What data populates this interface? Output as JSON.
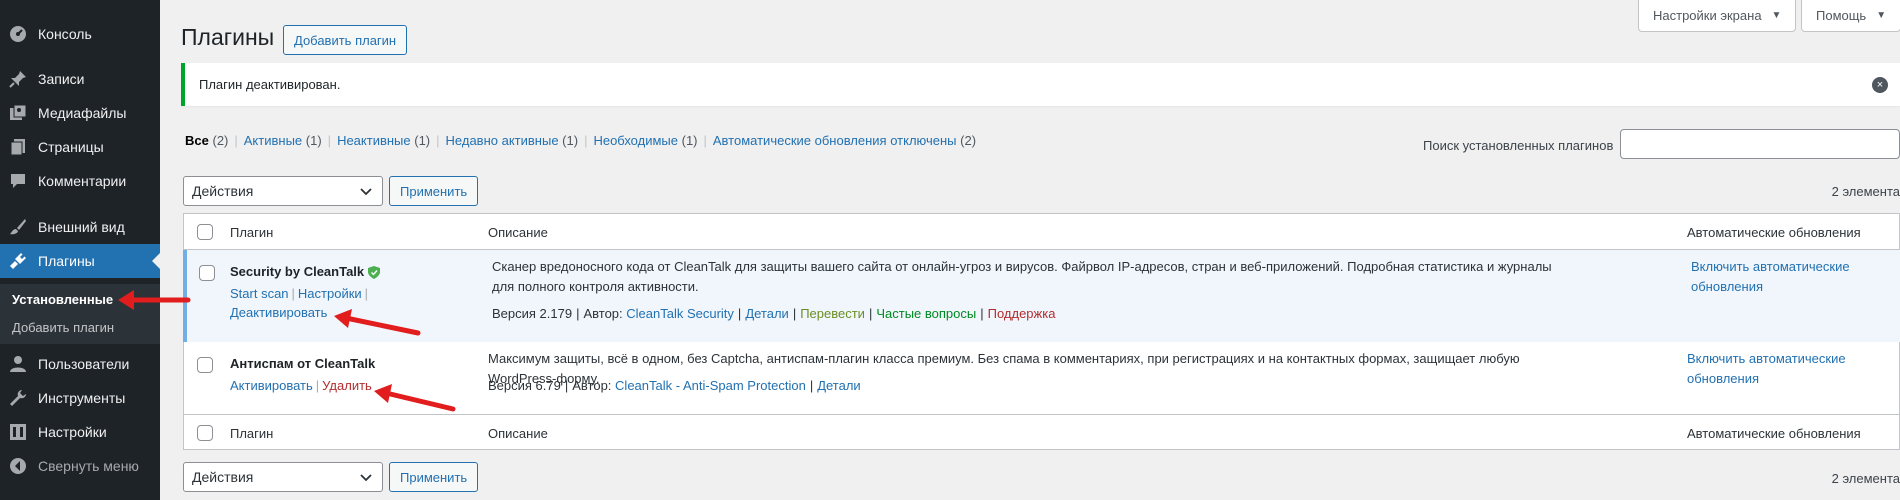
{
  "sidebar": {
    "items": [
      {
        "label": "Консоль",
        "icon": "dashboard-icon"
      },
      {
        "label": "Записи",
        "icon": "pin-icon"
      },
      {
        "label": "Медиафайлы",
        "icon": "media-icon"
      },
      {
        "label": "Страницы",
        "icon": "page-icon"
      },
      {
        "label": "Комментарии",
        "icon": "comment-icon"
      },
      {
        "label": "Внешний вид",
        "icon": "brush-icon"
      },
      {
        "label": "Плагины",
        "icon": "plugin-icon"
      },
      {
        "label": "Пользователи",
        "icon": "users-icon"
      },
      {
        "label": "Инструменты",
        "icon": "wrench-icon"
      },
      {
        "label": "Настройки",
        "icon": "settings-icon"
      },
      {
        "label": "Свернуть меню",
        "icon": "collapse-icon"
      }
    ],
    "submenu": [
      "Установленные",
      "Добавить плагин"
    ]
  },
  "top": {
    "screen_options": "Настройки экрана",
    "help": "Помощь"
  },
  "page": {
    "title": "Плагины",
    "add_new": "Добавить плагин"
  },
  "notice": {
    "text": "Плагин деактивирован."
  },
  "filters": [
    {
      "label": "Все",
      "count": "(2)"
    },
    {
      "label": "Активные",
      "count": "(1)"
    },
    {
      "label": "Неактивные",
      "count": "(1)"
    },
    {
      "label": "Недавно активные",
      "count": "(1)"
    },
    {
      "label": "Необходимые",
      "count": "(1)"
    },
    {
      "label": "Автоматические обновления отключены",
      "count": "(2)"
    }
  ],
  "search": {
    "label": "Поиск установленных плагинов"
  },
  "bulk": {
    "select": "Действия",
    "apply": "Применить",
    "count": "2 элемента"
  },
  "table": {
    "headers": {
      "name": "Плагин",
      "desc": "Описание",
      "auto": "Автоматические обновления"
    },
    "plugins": [
      {
        "name": "Security by CleanTalk",
        "actions": [
          "Start scan",
          "Настройки",
          "Деактивировать"
        ],
        "description": "Сканер вредоносного кода от CleanTalk для защиты вашего сайта от онлайн-угроз и вирусов. Файрвол IP-адресов, стран и веб-приложений. Подробная статистика и журналы для полного контроля активности.",
        "version": "Версия 2.179",
        "author_label": "Автор:",
        "author": "CleanTalk Security",
        "links": [
          "Детали",
          "Перевести",
          "Частые вопросы",
          "Поддержка"
        ],
        "auto_update": "Включить автоматические обновления"
      },
      {
        "name": "Антиспам от CleanTalk",
        "actions": [
          "Активировать",
          "Удалить"
        ],
        "description": "Максимум защиты, всё в одном, без Captcha, антиспам-плагин класса премиум. Без спама в комментариях, при регистрациях и на контактных формах, защищает любую WordPress-форму.",
        "version": "Версия 6.79",
        "author_label": "Автор:",
        "author": "CleanTalk - Anti-Spam Protection",
        "links": [
          "Детали"
        ],
        "auto_update": "Включить автоматические обновления"
      }
    ]
  },
  "colors": {
    "accent": "#2271b1",
    "sidebar": "#1d2327",
    "notice_green": "#00a32a",
    "arrow_red": "#e11d1d"
  }
}
